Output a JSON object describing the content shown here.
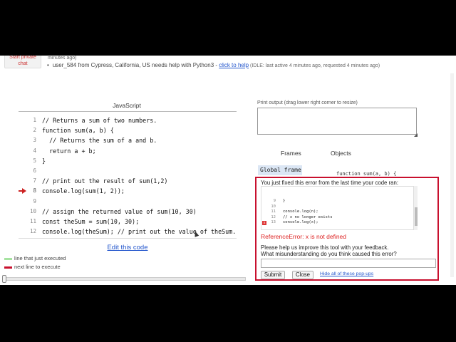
{
  "help": {
    "start_private_chat": "Start private chat",
    "previous_tail": "minutes ago)",
    "bullet": "•",
    "request_text": "user_584 from Cypress, California, US needs help with Python3 - ",
    "click_to_help": "click to help",
    "meta": " (IDLE: last active 4 minutes ago, requested 4 minutes ago)"
  },
  "code_panel": {
    "language": "JavaScript",
    "current_line": 8,
    "lines": [
      {
        "n": "1",
        "code": "// Returns a sum of two numbers."
      },
      {
        "n": "2",
        "code": "function sum(a, b) {"
      },
      {
        "n": "3",
        "code": "  // Returns the sum of a and b."
      },
      {
        "n": "4",
        "code": "  return a + b;"
      },
      {
        "n": "5",
        "code": "}"
      },
      {
        "n": "6",
        "code": ""
      },
      {
        "n": "7",
        "code": "// print out the result of sum(1,2)"
      },
      {
        "n": "8",
        "code": "console.log(sum(1, 2));"
      },
      {
        "n": "9",
        "code": ""
      },
      {
        "n": "10",
        "code": "// assign the returned value of sum(10, 30)"
      },
      {
        "n": "11",
        "code": "const theSum = sum(10, 30);"
      },
      {
        "n": "12",
        "code": "console.log(theSum); // print out the value of theSum."
      }
    ],
    "edit_link": "Edit this code"
  },
  "legend": {
    "executed": "line that just executed",
    "next": "next line to execute",
    "executed_color": "#a6e3a1",
    "next_color": "#c8102e"
  },
  "output": {
    "print_label": "Print output (drag lower right corner to resize)",
    "frames_tab": "Frames",
    "objects_tab": "Objects",
    "global_frame": "Global frame",
    "object_peek": "function sum(a, b) {"
  },
  "popup": {
    "heading": "You just fixed this error from the last time your code ran:",
    "mini_code": [
      {
        "n": "9",
        "code": "}"
      },
      {
        "n": "10",
        "code": ""
      },
      {
        "n": "11",
        "code": "console.log(n);"
      },
      {
        "n": "12",
        "code": "// x no longer exists"
      },
      {
        "n": "13",
        "code": "console.log(x);",
        "error": true
      }
    ],
    "error_mark": "x",
    "error_message": "ReferenceError: x is not defined",
    "feedback_line1": "Please help us improve this tool with your feedback.",
    "feedback_line2": "What misunderstanding do you think caused this error?",
    "submit": "Submit",
    "close": "Close",
    "hide_all": "Hide all of these pop-ups",
    "border_color": "#c8102e"
  }
}
